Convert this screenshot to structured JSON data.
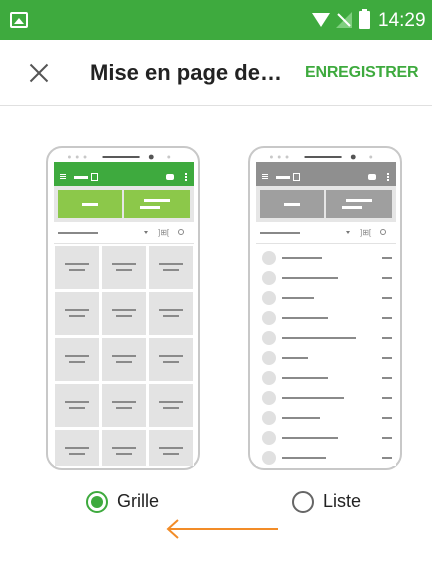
{
  "status_bar": {
    "time": "14:29",
    "icons": [
      "image-icon",
      "wifi-icon",
      "signal-icon",
      "battery-icon"
    ]
  },
  "app_bar": {
    "title": "Mise en page de…",
    "save_label": "ENREGISTRER",
    "close_icon": "close-icon"
  },
  "options": [
    {
      "label": "Grille",
      "selected": true
    },
    {
      "label": "Liste",
      "selected": false
    }
  ],
  "colors": {
    "accent": "#3eaa3e",
    "light_accent": "#8cc84a",
    "arrow": "#f28c28",
    "muted": "#8f8f8f"
  }
}
